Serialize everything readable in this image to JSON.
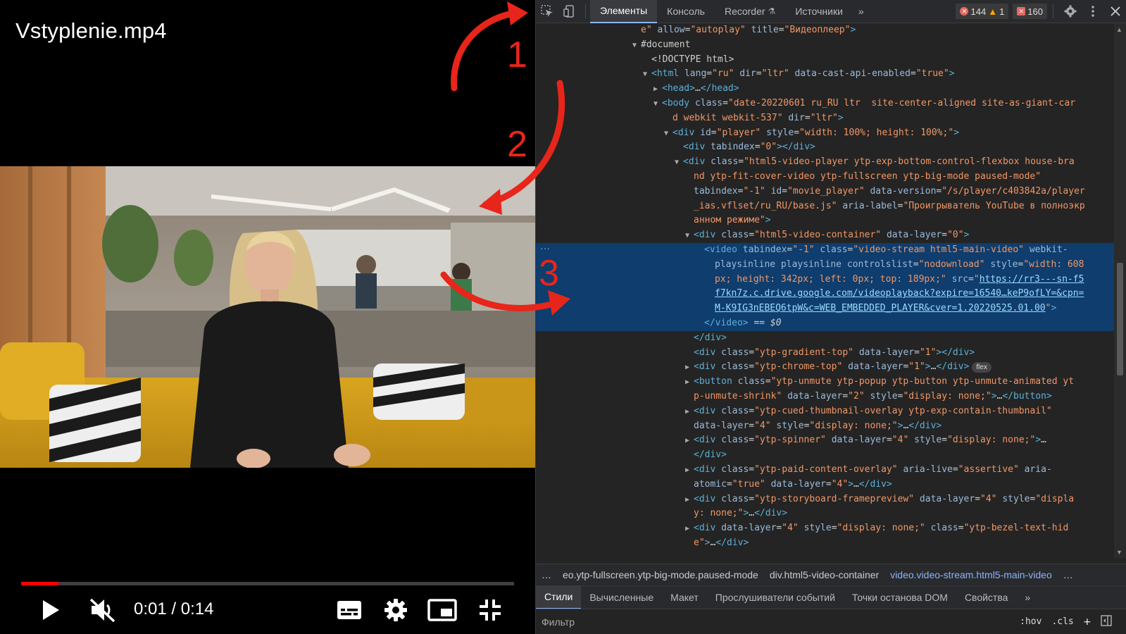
{
  "player": {
    "title": "Vstyplenie.mp4",
    "current_time": "0:01",
    "time_separator": " / ",
    "duration": "0:14",
    "progress_fraction": 0.075,
    "accent_color": "#ff0000",
    "icons": {
      "play": "play-icon",
      "mute": "volume-muted-icon",
      "subtitles": "subtitles-icon",
      "settings": "gear-icon",
      "miniplayer": "miniplayer-icon",
      "exit_fullscreen": "exit-fullscreen-icon"
    }
  },
  "annotations": {
    "labels": [
      "1",
      "2",
      "3"
    ],
    "color": "#e8251a"
  },
  "devtools": {
    "toolbar": {
      "tabs": [
        {
          "label": "Элементы"
        },
        {
          "label": "Консоль"
        },
        {
          "label": "Recorder"
        },
        {
          "label": "Источники"
        }
      ],
      "more_tabs": "»",
      "errors": "144",
      "warnings": "1",
      "issues": "160"
    },
    "dom_lines": [
      {
        "indent": 9,
        "tog": "",
        "html": "<span class='v'>e\"</span> <span class='a'>allow</span>=<span class='v'>\"autoplay\"</span> <span class='a'>title</span>=<span class='v'>\"Видеоплеер\"</span><span class='t'>&gt;</span>"
      },
      {
        "indent": 9,
        "tog": "▼",
        "html": "<span class='m'>#document</span>"
      },
      {
        "indent": 10,
        "tog": "",
        "html": "<span class='m'>&lt;!DOCTYPE html&gt;</span>"
      },
      {
        "indent": 10,
        "tog": "▼",
        "html": "<span class='t'>&lt;html</span> <span class='a'>lang</span>=<span class='v'>\"ru\"</span> <span class='a'>dir</span>=<span class='v'>\"ltr\"</span> <span class='a'>data-cast-api-enabled</span>=<span class='v'>\"true\"</span><span class='t'>&gt;</span>"
      },
      {
        "indent": 11,
        "tog": "▶",
        "html": "<span class='t'>&lt;head&gt;</span><span class='m'>…</span><span class='t'>&lt;/head&gt;</span>"
      },
      {
        "indent": 11,
        "tog": "▼",
        "html": "<span class='t'>&lt;body</span> <span class='a'>class</span>=<span class='v'>\"date-20220601 ru_RU ltr  site-center-aligned site-as-giant-car</span>"
      },
      {
        "indent": 12,
        "tog": "",
        "html": "<span class='v'>d webkit webkit-537\"</span> <span class='a'>dir</span>=<span class='v'>\"ltr\"</span><span class='t'>&gt;</span>"
      },
      {
        "indent": 12,
        "tog": "▼",
        "html": "<span class='t'>&lt;div</span> <span class='a'>id</span>=<span class='v'>\"player\"</span> <span class='a'>style</span>=<span class='v'>\"width: 100%; height: 100%;\"</span><span class='t'>&gt;</span>"
      },
      {
        "indent": 13,
        "tog": "",
        "html": "<span class='t'>&lt;div</span> <span class='a'>tabindex</span>=<span class='v'>\"0\"</span><span class='t'>&gt;&lt;/div&gt;</span>"
      },
      {
        "indent": 13,
        "tog": "▼",
        "html": "<span class='t'>&lt;div</span> <span class='a'>class</span>=<span class='v'>\"html5-video-player ytp-exp-bottom-control-flexbox house-bra</span>"
      },
      {
        "indent": 14,
        "tog": "",
        "html": "<span class='v'>nd ytp-fit-cover-video ytp-fullscreen ytp-big-mode paused-mode\"</span>"
      },
      {
        "indent": 14,
        "tog": "",
        "html": "<span class='a'>tabindex</span>=<span class='v'>\"-1\"</span> <span class='a'>id</span>=<span class='v'>\"movie_player\"</span> <span class='a'>data-version</span>=<span class='v'>\"/s/player/c403842a/player</span>"
      },
      {
        "indent": 14,
        "tog": "",
        "html": "<span class='v'>_ias.vflset/ru_RU/base.js\"</span> <span class='a'>aria-label</span>=<span class='v'>\"Проигрыватель YouTube в полноэкр</span>"
      },
      {
        "indent": 14,
        "tog": "",
        "html": "<span class='v'>анном режиме\"</span><span class='t'>&gt;</span>"
      },
      {
        "indent": 14,
        "tog": "▼",
        "html": "<span class='t'>&lt;div</span> <span class='a'>class</span>=<span class='v'>\"html5-video-container\"</span> <span class='a'>data-layer</span>=<span class='v'>\"0\"</span><span class='t'>&gt;</span>"
      },
      {
        "indent": 15,
        "tog": "",
        "sel": true,
        "html": "<span class='t'>&lt;video</span> <span class='a'>tabindex</span>=<span class='v'>\"-1\"</span> <span class='a'>class</span>=<span class='v'>\"video-stream html5-main-video\"</span> <span class='a'>webkit-</span>"
      },
      {
        "indent": 16,
        "tog": "",
        "sel": true,
        "html": "<span class='a'>playsinline playsinline controlslist</span>=<span class='v'>\"nodownload\"</span> <span class='a'>style</span>=<span class='v'>\"width: 608</span>"
      },
      {
        "indent": 16,
        "tog": "",
        "sel": true,
        "html": "<span class='v'>px; height: 342px; left: 0px; top: 189px;\"</span> <span class='a'>src</span>=<span class='v'>\"</span><span class='u'>https://rr3---sn-f5</span>"
      },
      {
        "indent": 16,
        "tog": "",
        "sel": true,
        "html": "<span class='u'>f7kn7z.c.drive.google.com/videoplayback?expire=16540…keP9ofLY=&amp;cpn=</span>"
      },
      {
        "indent": 16,
        "tog": "",
        "sel": true,
        "html": "<span class='u'>M-K9IG3nEBEQ6tpW&amp;c=WEB_EMBEDDED_PLAYER&amp;cver=1.20220525.01.00</span><span class='v'>\"</span><span class='t'>&gt;</span>"
      },
      {
        "indent": 15,
        "tog": "",
        "sel": true,
        "html": "<span class='t'>&lt;/video&gt;</span> <span class='dom-ref'>== $0</span>"
      },
      {
        "indent": 14,
        "tog": "",
        "html": "<span class='t'>&lt;/div&gt;</span>"
      },
      {
        "indent": 14,
        "tog": "",
        "html": "<span class='t'>&lt;div</span> <span class='a'>class</span>=<span class='v'>\"ytp-gradient-top\"</span> <span class='a'>data-layer</span>=<span class='v'>\"1\"</span><span class='t'>&gt;&lt;/div&gt;</span>"
      },
      {
        "indent": 14,
        "tog": "▶",
        "html": "<span class='t'>&lt;div</span> <span class='a'>class</span>=<span class='v'>\"ytp-chrome-top\"</span> <span class='a'>data-layer</span>=<span class='v'>\"1\"</span><span class='t'>&gt;</span><span class='m'>…</span><span class='t'>&lt;/div&gt;</span><span class='flex-badge'>flex</span>"
      },
      {
        "indent": 14,
        "tog": "▶",
        "html": "<span class='t'>&lt;button</span> <span class='a'>class</span>=<span class='v'>\"ytp-unmute ytp-popup ytp-button ytp-unmute-animated yt</span>"
      },
      {
        "indent": 14,
        "tog": "",
        "html": "<span class='v'>p-unmute-shrink\"</span> <span class='a'>data-layer</span>=<span class='v'>\"2\"</span> <span class='a'>style</span>=<span class='v'>\"display: none;\"</span><span class='t'>&gt;</span><span class='m'>…</span><span class='t'>&lt;/button&gt;</span>"
      },
      {
        "indent": 14,
        "tog": "▶",
        "html": "<span class='t'>&lt;div</span> <span class='a'>class</span>=<span class='v'>\"ytp-cued-thumbnail-overlay ytp-exp-contain-thumbnail\"</span>"
      },
      {
        "indent": 14,
        "tog": "",
        "html": "<span class='a'>data-layer</span>=<span class='v'>\"4\"</span> <span class='a'>style</span>=<span class='v'>\"display: none;\"</span><span class='t'>&gt;</span><span class='m'>…</span><span class='t'>&lt;/div&gt;</span>"
      },
      {
        "indent": 14,
        "tog": "▶",
        "html": "<span class='t'>&lt;div</span> <span class='a'>class</span>=<span class='v'>\"ytp-spinner\"</span> <span class='a'>data-layer</span>=<span class='v'>\"4\"</span> <span class='a'>style</span>=<span class='v'>\"display: none;\"</span><span class='t'>&gt;</span><span class='m'>…</span>"
      },
      {
        "indent": 14,
        "tog": "",
        "html": "<span class='t'>&lt;/div&gt;</span>"
      },
      {
        "indent": 14,
        "tog": "▶",
        "html": "<span class='t'>&lt;div</span> <span class='a'>class</span>=<span class='v'>\"ytp-paid-content-overlay\"</span> <span class='a'>aria-live</span>=<span class='v'>\"assertive\"</span> <span class='a'>aria-</span>"
      },
      {
        "indent": 14,
        "tog": "",
        "html": "<span class='a'>atomic</span>=<span class='v'>\"true\"</span> <span class='a'>data-layer</span>=<span class='v'>\"4\"</span><span class='t'>&gt;</span><span class='m'>…</span><span class='t'>&lt;/div&gt;</span>"
      },
      {
        "indent": 14,
        "tog": "▶",
        "html": "<span class='t'>&lt;div</span> <span class='a'>class</span>=<span class='v'>\"ytp-storyboard-framepreview\"</span> <span class='a'>data-layer</span>=<span class='v'>\"4\"</span> <span class='a'>style</span>=<span class='v'>\"displa</span>"
      },
      {
        "indent": 14,
        "tog": "",
        "html": "<span class='v'>y: none;\"</span><span class='t'>&gt;</span><span class='m'>…</span><span class='t'>&lt;/div&gt;</span>"
      },
      {
        "indent": 14,
        "tog": "▶",
        "html": "<span class='t'>&lt;div</span> <span class='a'>data-layer</span>=<span class='v'>\"4\"</span> <span class='a'>style</span>=<span class='v'>\"display: none;\"</span> <span class='a'>class</span>=<span class='v'>\"ytp-bezel-text-hid</span>"
      },
      {
        "indent": 14,
        "tog": "",
        "html": "<span class='v'>e\"</span><span class='t'>&gt;</span><span class='m'>…</span><span class='t'>&lt;/div&gt;</span>"
      }
    ],
    "breadcrumbs": [
      {
        "label": "…"
      },
      {
        "label": "eo.ytp-fullscreen.ytp-big-mode.paused-mode"
      },
      {
        "label": "div.html5-video-container"
      },
      {
        "label": "video.video-stream.html5-main-video",
        "active": true
      },
      {
        "label": "…"
      }
    ],
    "bottom_tabs": [
      {
        "label": "Стили",
        "active": true
      },
      {
        "label": "Вычисленные"
      },
      {
        "label": "Макет"
      },
      {
        "label": "Прослушиватели событий"
      },
      {
        "label": "Точки останова DOM"
      },
      {
        "label": "Свойства"
      }
    ],
    "bottom_more": "»",
    "filter": {
      "placeholder": "Фильтр",
      "hov": ":hov",
      "cls": ".cls",
      "plus": "+"
    }
  }
}
